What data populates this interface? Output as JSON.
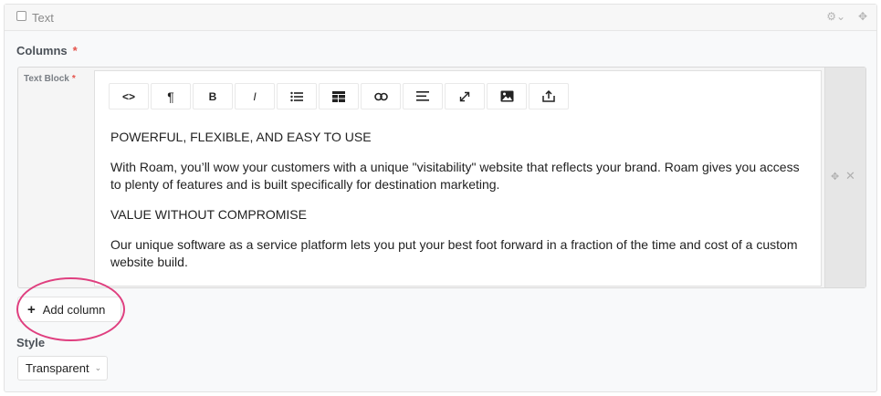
{
  "block": {
    "type_label": "Text"
  },
  "columns_field": {
    "label": "Columns",
    "required_mark": "*",
    "row_label": "Text Block",
    "row_required_mark": "*"
  },
  "toolbar": {
    "buttons": [
      {
        "name": "html-source",
        "glyph": "<>"
      },
      {
        "name": "paragraph-format",
        "glyph": "¶"
      },
      {
        "name": "bold",
        "glyph": "B"
      },
      {
        "name": "italic",
        "glyph": "I"
      },
      {
        "name": "unordered-list",
        "glyph": ""
      },
      {
        "name": "table",
        "glyph": ""
      },
      {
        "name": "link",
        "glyph": ""
      },
      {
        "name": "align",
        "glyph": ""
      },
      {
        "name": "fullscreen",
        "glyph": ""
      },
      {
        "name": "image",
        "glyph": ""
      },
      {
        "name": "upload",
        "glyph": ""
      }
    ]
  },
  "content": {
    "heading1": "POWERFUL, FLEXIBLE, AND EASY TO USE",
    "para1": "With Roam, you’ll wow your customers with a unique \"visitability\" website that reflects your brand. Roam gives you access to plenty of features and is built specifically for destination marketing.",
    "heading2": "VALUE WITHOUT COMPROMISE",
    "para2": "Our unique software as a service platform lets you put your best foot forward in a fraction of the time and cost of a custom website build."
  },
  "add_column": {
    "label": "Add column"
  },
  "style_field": {
    "label": "Style",
    "selected": "Transparent"
  },
  "colors": {
    "highlight_ring": "#df3f7f",
    "required": "#e5534b"
  }
}
